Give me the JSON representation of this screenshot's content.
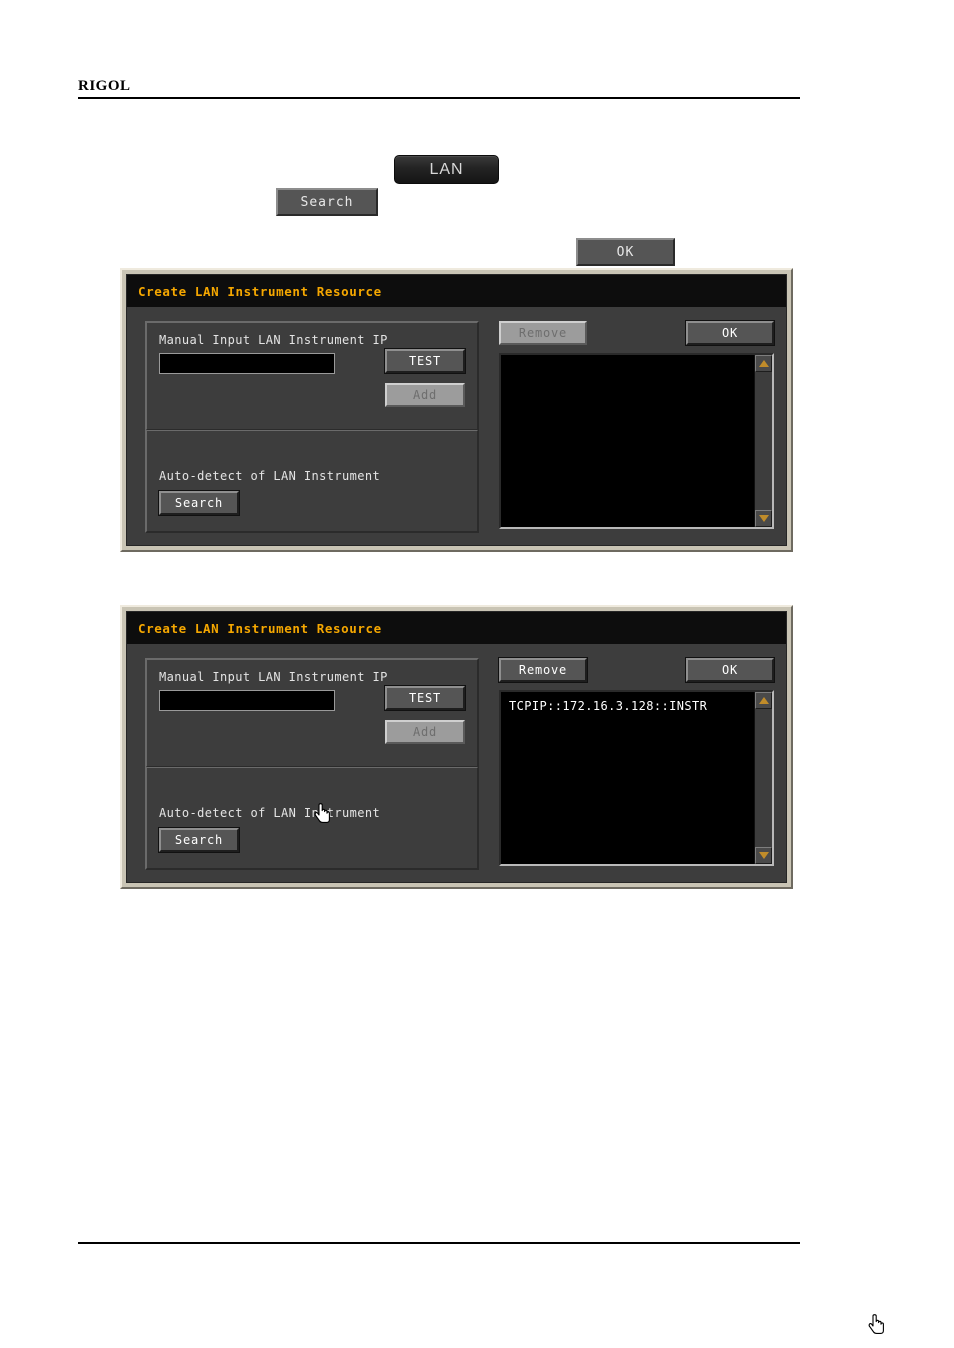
{
  "page": {
    "brand": "RIGOL"
  },
  "instrument_keys": {
    "lan": "LAN",
    "search": "Search",
    "ok": "OK"
  },
  "dialogs": [
    {
      "id": "dialog-search-empty",
      "title": "Create LAN Instrument Resource",
      "manual": {
        "label": "Manual Input LAN Instrument IP",
        "input_value": "",
        "input_placeholder": "",
        "test_label": "TEST",
        "test_enabled": true,
        "add_label": "Add",
        "add_enabled": false
      },
      "auto": {
        "label": "Auto-detect of LAN Instrument",
        "search_label": "Search",
        "search_enabled": true
      },
      "resources": {
        "remove_label": "Remove",
        "remove_enabled": false,
        "ok_label": "OK",
        "ok_enabled": true,
        "items": []
      },
      "cursor_on": "search-button"
    },
    {
      "id": "dialog-search-result",
      "title": "Create LAN Instrument Resource",
      "manual": {
        "label": "Manual Input LAN Instrument IP",
        "input_value": "",
        "input_placeholder": "",
        "test_label": "TEST",
        "test_enabled": true,
        "add_label": "Add",
        "add_enabled": false
      },
      "auto": {
        "label": "Auto-detect of LAN Instrument",
        "search_label": "Search",
        "search_enabled": true
      },
      "resources": {
        "remove_label": "Remove",
        "remove_enabled": true,
        "ok_label": "OK",
        "ok_enabled": true,
        "items": [
          "TCPIP::172.16.3.128::INSTR"
        ]
      },
      "cursor_on": "ok-button"
    }
  ],
  "colors": {
    "title_text": "#f5a700",
    "dialog_face": "#3d3d3d",
    "dialog_frame": "#c9c4b4",
    "list_background": "#000000",
    "list_text": "#ffffff",
    "scroll_arrow": "#c08c2a"
  }
}
